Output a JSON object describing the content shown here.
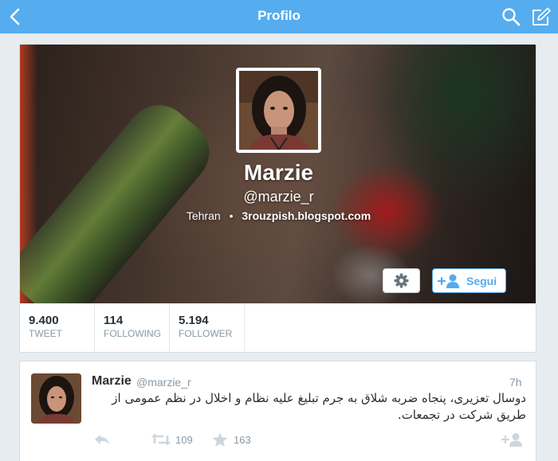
{
  "navbar": {
    "title": "Profilo"
  },
  "profile": {
    "name": "Marzie",
    "handle": "@marzie_r",
    "location": "Tehran",
    "separator": "•",
    "url": "3rouzpish.blogspot.com"
  },
  "stats": [
    {
      "value": "9.400",
      "label": "TWEET"
    },
    {
      "value": "114",
      "label": "FOLLOWING"
    },
    {
      "value": "5.194",
      "label": "FOLLOWER"
    }
  ],
  "actions": {
    "follow_label": "Segui"
  },
  "tweet": {
    "name": "Marzie",
    "handle": "@marzie_r",
    "time": "7h",
    "text": "دوسال تعزیری، پنجاه ضربه شلاق به جرم تبلیغ علیه نظام و اخلال در نظم عمومی از طریق شرکت در تجمعات.",
    "retweets": "109",
    "favorites": "163"
  },
  "colors": {
    "accent": "#55acee",
    "muted": "#8899a6",
    "text": "#292f33",
    "background": "#e6ecf0"
  }
}
